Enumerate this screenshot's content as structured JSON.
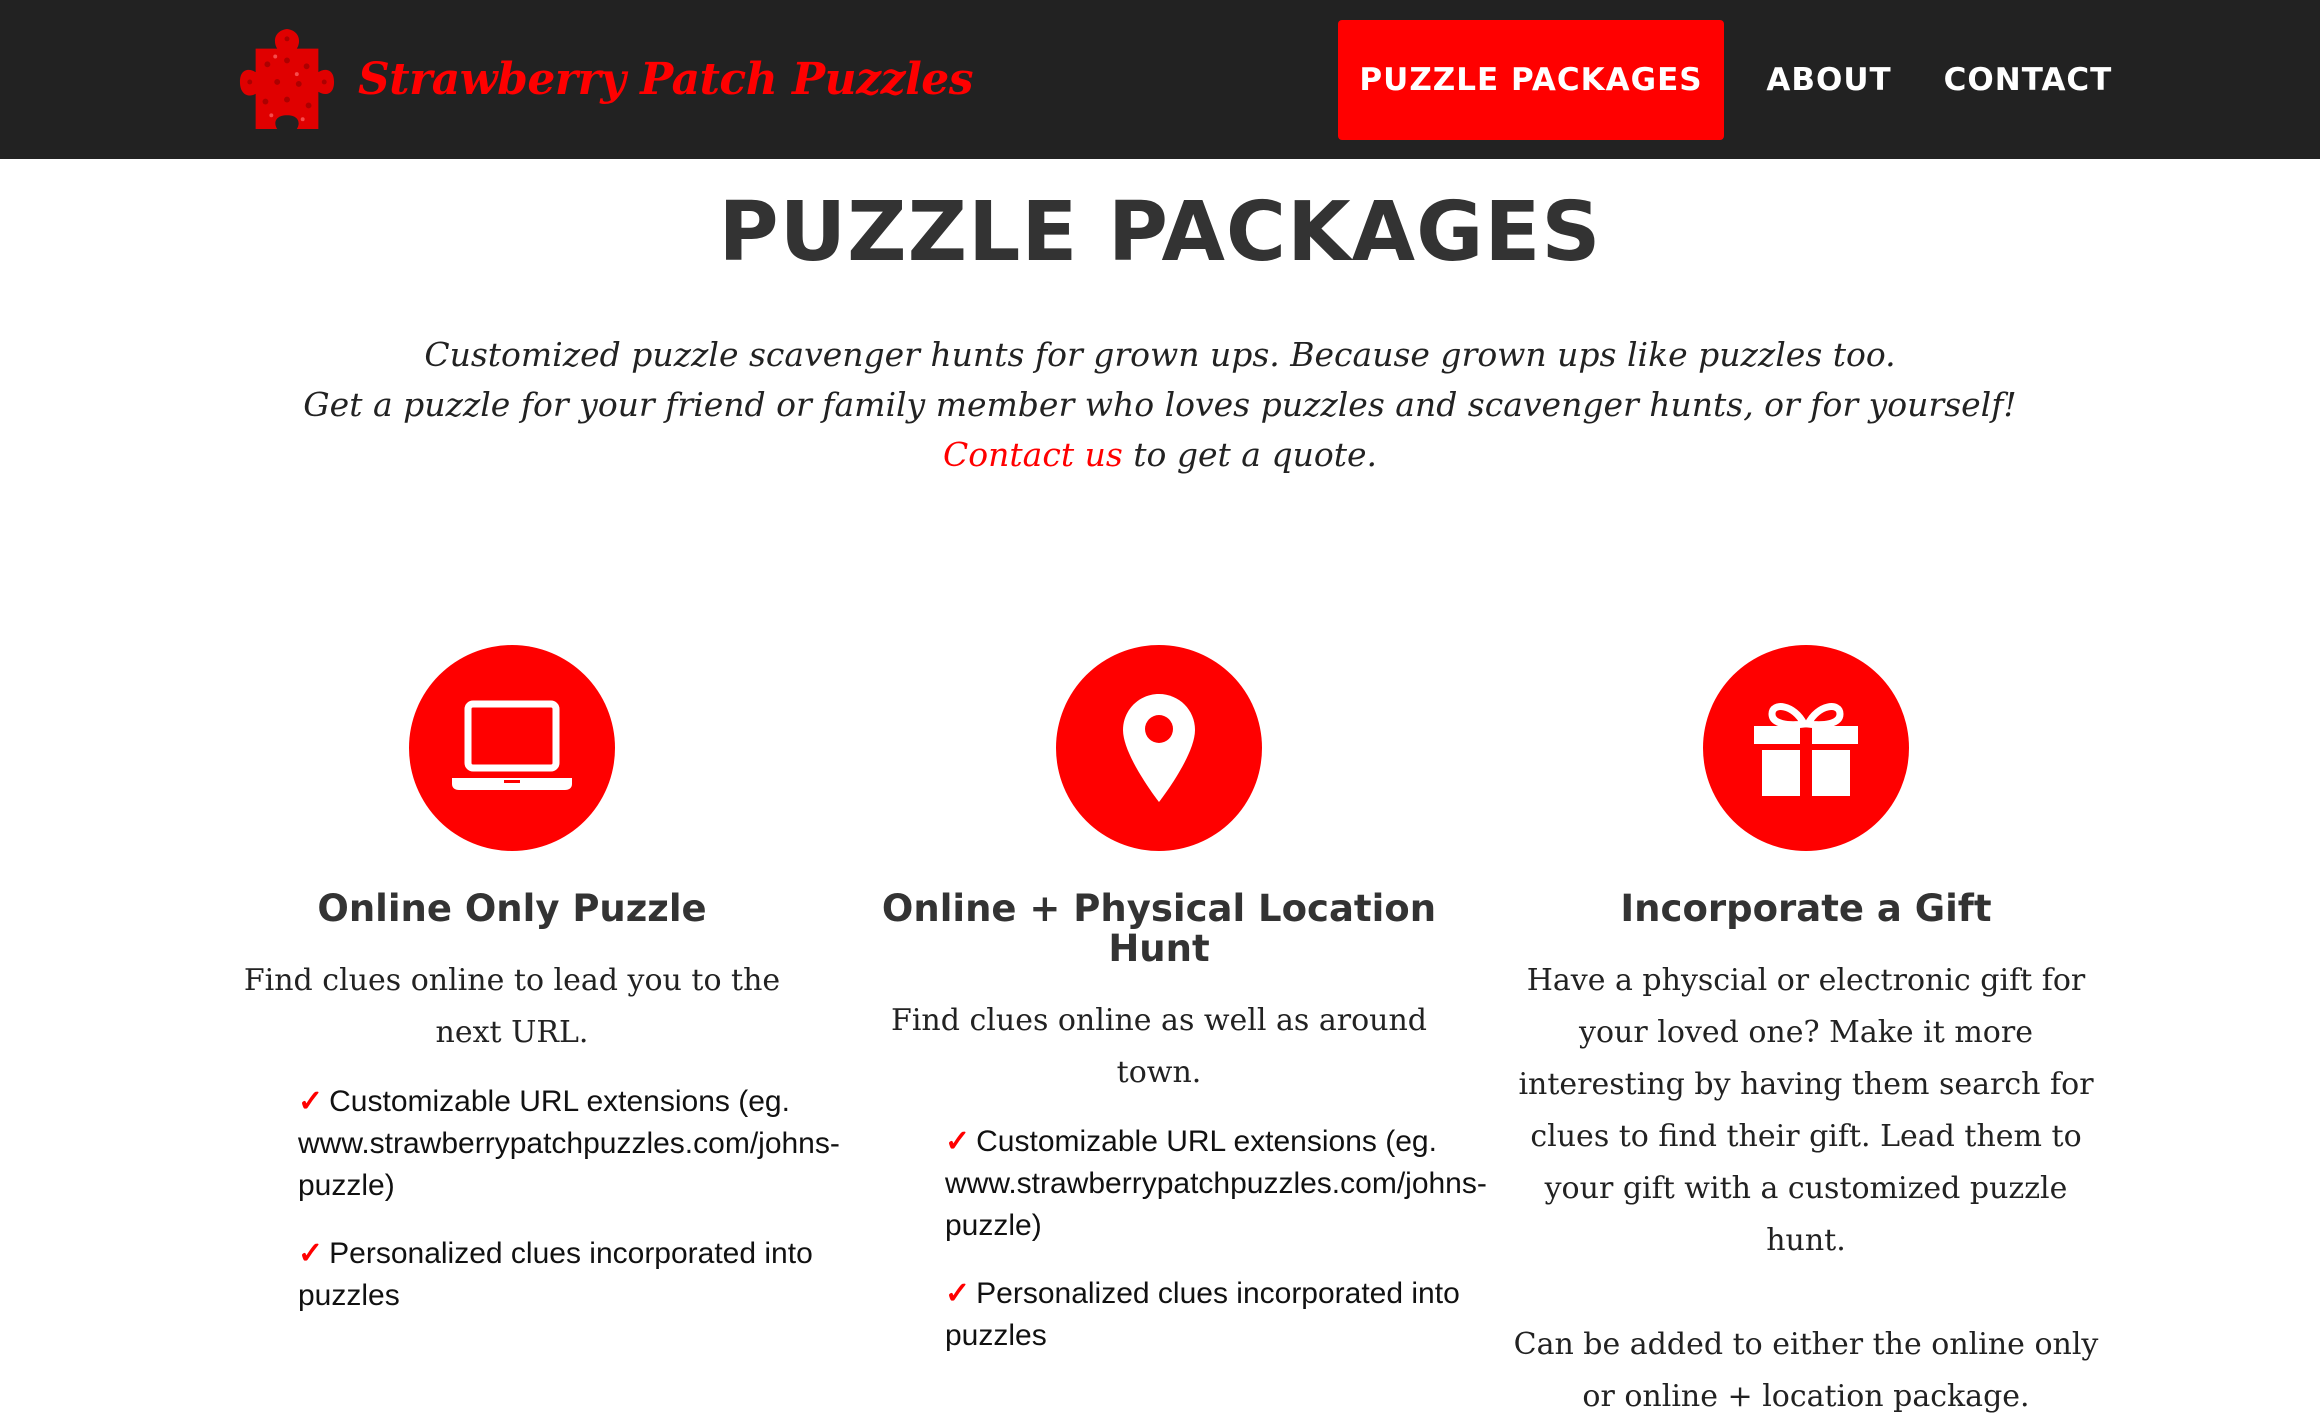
{
  "brand": {
    "name": "Strawberry Patch Puzzles",
    "accent": "#ff0000",
    "header_bg": "#222222"
  },
  "nav": {
    "items": [
      {
        "label": "PUZZLE PACKAGES",
        "active": true
      },
      {
        "label": "ABOUT",
        "active": false
      },
      {
        "label": "CONTACT",
        "active": false
      }
    ]
  },
  "page": {
    "title": "PUZZLE PACKAGES",
    "intro_line1": "Customized puzzle scavenger hunts for grown ups. Because grown ups like puzzles too.",
    "intro_line2": "Get a puzzle for your friend or family member who loves puzzles and scavenger hunts, or for yourself!",
    "contact_link": "Contact us",
    "intro_line3_rest": " to get a quote."
  },
  "packages": [
    {
      "icon": "laptop-icon",
      "title": "Online Only Puzzle",
      "description": "Find clues online to lead you to the next URL.",
      "features": [
        {
          "check": "✓",
          "text": "Customizable URL extensions (eg. www.strawberrypatchpuzzles.com/johns-puzzle)"
        },
        {
          "check": "✓",
          "text": "Personalized clues incorporated into puzzles"
        }
      ]
    },
    {
      "icon": "map-pin-icon",
      "title": "Online + Physical Location Hunt",
      "description": "Find clues online as well as around town.",
      "features": [
        {
          "check": "✓",
          "text": "Customizable URL extensions (eg. www.strawberrypatchpuzzles.com/johns-puzzle)"
        },
        {
          "check": "✓",
          "text": "Personalized clues incorporated into puzzles"
        }
      ]
    },
    {
      "icon": "gift-icon",
      "title": "Incorporate a Gift",
      "description": "Have a physcial or electronic gift for your loved one? Make it more interesting by having them search for clues to find their gift. Lead them to your gift with a customized puzzle hunt.",
      "note": "Can be added to either the online only or online + location package."
    }
  ]
}
